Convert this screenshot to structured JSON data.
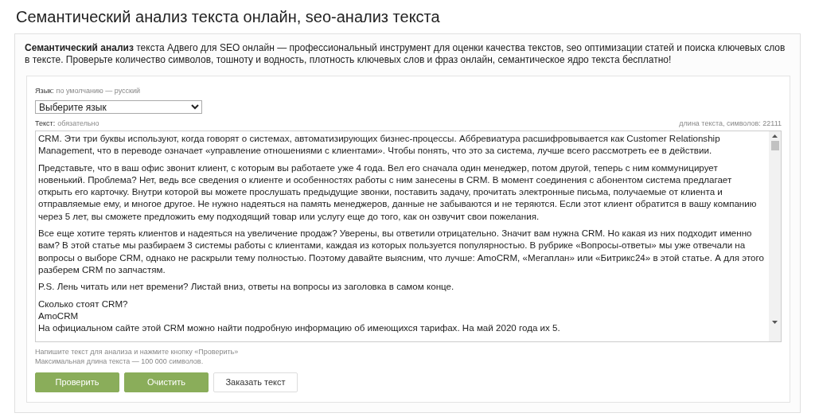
{
  "page_title": "Семантический анализ текста онлайн, seo-анализ текста",
  "intro": {
    "text": "**Семантический анализ** текста Адвего для SEO онлайн — профессиональный инструмент для оценки качества текстов, seo оптимизации статей и поиска ключевых слов в тексте. Проверьте количество символов, тошноту и водность, плотность ключевых слов и фраз онлайн, семантическое ядро текста бесплатно!"
  },
  "language": {
    "label": "Язык:",
    "hint": "по умолчанию — русский",
    "value": "Выберите язык"
  },
  "text_field": {
    "label": "Текст:",
    "hint": "обязательно",
    "length": "длина текста, символов: 22111",
    "paragraphs": [
      {
        "lines": [
          "CRM. Эти три буквы используют, когда говорят о системах, автоматизирующих бизнес-процессы. Аббревиатура расшифровывается как Customer Relationship Management, что в переводе означает «управление отношениями с клиентами». Чтобы понять, что это за система, лучше всего рассмотреть ее в действии."
        ]
      },
      {
        "lines": [
          "Представьте, что в ваш офис звонит клиент, с которым вы работаете уже 4 года. Вел его сначала один менеджер, потом другой, теперь с ним коммуницирует новенький. Проблема? Нет, ведь все сведения о клиенте и особенностях работы с ним занесены в CRM. В момент соединения с абонентом система предлагает открыть его карточку. Внутри которой вы можете прослушать предыдущие звонки, поставить задачу, прочитать электронные письма, получаемые от клиента и отправляемые ему, и многое другое. Не нужно надеяться на память менеджеров, данные не забываются и не теряются. Если этот клиент обратится в вашу компанию через 5 лет, вы сможете предложить ему подходящий товар или услугу еще до того, как он озвучит свои пожелания."
        ]
      },
      {
        "lines": [
          "Все еще хотите терять клиентов и надеяться на увеличение продаж? Уверены, вы ответили отрицательно. Значит вам нужна CRM. Но какая из них подходит именно вам? В этой статье мы разбираем 3 системы работы с клиентами, каждая из которых пользуется популярностью. В рубрике «Вопросы-ответы» мы уже отвечали на вопросы о выборе CRM, однако не раскрыли тему полностью. Поэтому давайте выясним, что лучше: AmoCRM, «Мегаплан» или «Битрикс24» в этой статье. А для этого разберем CRM по запчастям."
        ]
      },
      {
        "lines": [
          "P.S. Лень читать или нет времени? Листай вниз, ответы на вопросы из заголовка в самом конце."
        ]
      },
      {
        "lines": [
          "Сколько стоят CRM?",
          "AmoCRM",
          "На официальном сайте этой CRM можно найти подробную информацию об имеющихся тарифах. На май 2020 года их 5."
        ]
      }
    ],
    "help": [
      "Напишите текст для анализа и нажмите кнопку «Проверить»",
      "Максимальная длина текста — 100 000 символов."
    ]
  },
  "buttons": [
    {
      "label": "Проверить",
      "kind": "primary"
    },
    {
      "label": "Очистить",
      "kind": "primary"
    },
    {
      "label": "Заказать текст",
      "kind": "secondary"
    }
  ]
}
